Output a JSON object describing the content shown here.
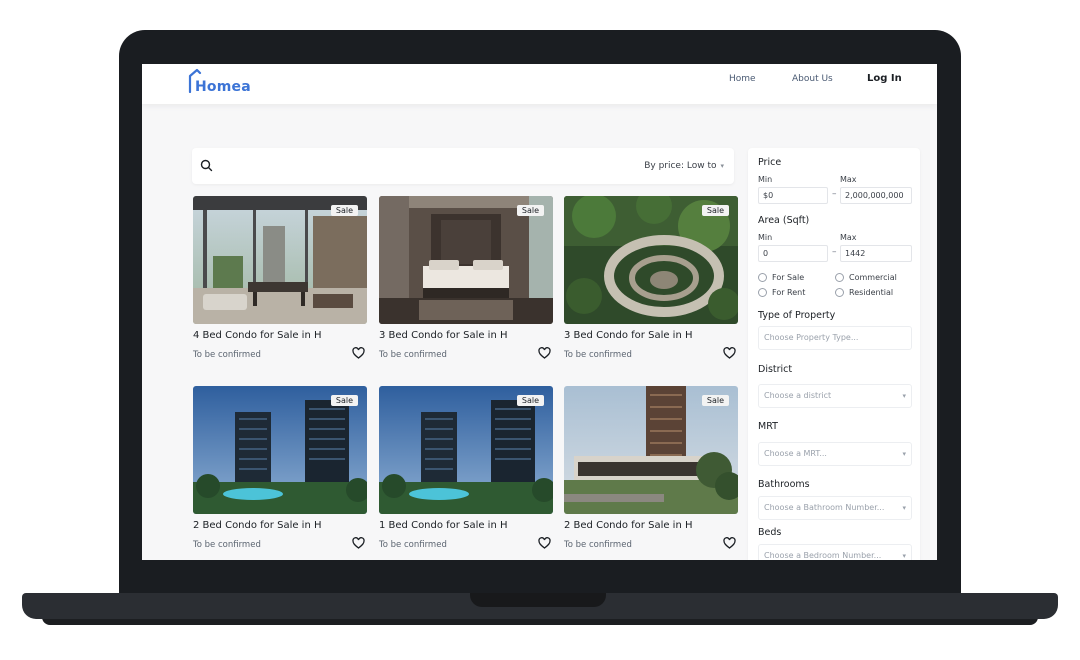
{
  "nav": {
    "logo": "Homea",
    "links": [
      "Home",
      "About Us",
      "Log In"
    ]
  },
  "search": {
    "placeholder": "",
    "sort_label": "By price: Low to"
  },
  "listings": [
    {
      "title": "4 Bed Condo for Sale in H",
      "price": "To be confirmed",
      "badge": "Sale"
    },
    {
      "title": "3 Bed Condo for Sale in H",
      "price": "To be confirmed",
      "badge": "Sale"
    },
    {
      "title": "3 Bed Condo for Sale in H",
      "price": "To be confirmed",
      "badge": "Sale"
    },
    {
      "title": "2 Bed Condo for Sale in H",
      "price": "To be confirmed",
      "badge": "Sale"
    },
    {
      "title": "1 Bed Condo for Sale in H",
      "price": "To be confirmed",
      "badge": "Sale"
    },
    {
      "title": "2 Bed Condo for Sale in H",
      "price": "To be confirmed",
      "badge": "Sale"
    }
  ],
  "filters": {
    "price": {
      "label": "Price",
      "min_label": "Min",
      "max_label": "Max",
      "min_value": "$0",
      "max_value": "2,000,000,000"
    },
    "area": {
      "label": "Area (Sqft)",
      "min_label": "Min",
      "max_label": "Max",
      "min_value": "0",
      "max_value": "1442"
    },
    "radios": [
      "For Sale",
      "Commercial",
      "For Rent",
      "Residential"
    ],
    "property_type": {
      "label": "Type of Property",
      "placeholder": "Choose Property Type..."
    },
    "district": {
      "label": "District",
      "placeholder": "Choose a district"
    },
    "mrt": {
      "label": "MRT",
      "placeholder": "Choose a MRT..."
    },
    "bathrooms": {
      "label": "Bathrooms",
      "placeholder": "Choose a Bathroom Number..."
    },
    "beds": {
      "label": "Beds",
      "placeholder": "Choose a Bedroom Number..."
    }
  },
  "colors": {
    "brand": "#3c74d6",
    "frame": "#1a1d21"
  }
}
